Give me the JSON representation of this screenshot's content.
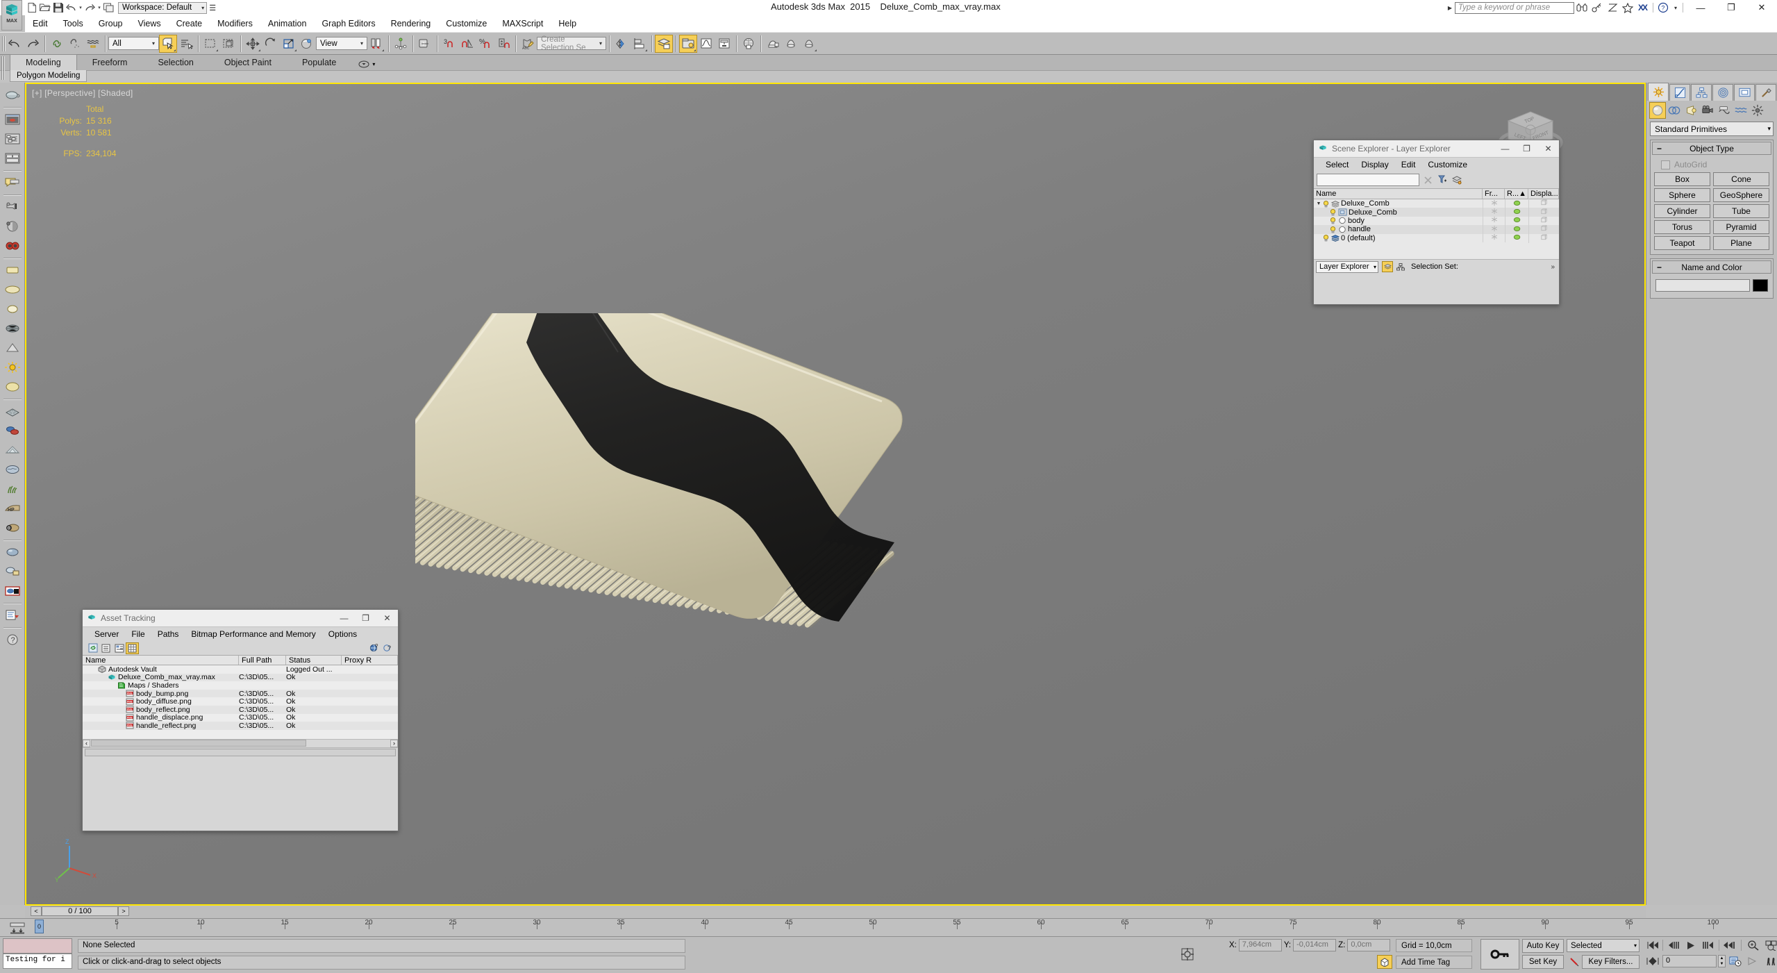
{
  "app": {
    "title": "Autodesk 3ds Max  2015    Deluxe_Comb_max_vray.max",
    "logo_label": "MAX"
  },
  "quick_access": {
    "workspace_label": "Workspace: Default",
    "items": [
      "new-icon",
      "open-icon",
      "save-icon",
      "undo-icon",
      "redo-icon",
      "project-folder-icon"
    ]
  },
  "search": {
    "placeholder": "Type a keyword or phrase"
  },
  "window_buttons": {
    "minimize": "—",
    "maximize": "❐",
    "close": "✕"
  },
  "menubar": {
    "items": [
      "Edit",
      "Tools",
      "Group",
      "Views",
      "Create",
      "Modifiers",
      "Animation",
      "Graph Editors",
      "Rendering",
      "Customize",
      "MAXScript",
      "Help"
    ]
  },
  "main_toolbar": {
    "selection_filter": "All",
    "reference_coord": "View",
    "named_selection_sets": "Create Selection Se",
    "axis_constraint_number": "3"
  },
  "ribbon": {
    "tabs": [
      "Modeling",
      "Freeform",
      "Selection",
      "Object Paint",
      "Populate"
    ],
    "active_tab": "Modeling",
    "panel_label": "Polygon Modeling"
  },
  "viewport": {
    "label": "[+] [Perspective] [Shaded]",
    "stats": {
      "header": "Total",
      "polys_label": "Polys:",
      "polys_value": "15 316",
      "verts_label": "Verts:",
      "verts_value": "10 581",
      "fps_label": "FPS:",
      "fps_value": "234,104"
    },
    "background_color": "#7e7e7e",
    "border_color": "#ffe600",
    "model": {
      "body_color": "#d8d2b8",
      "handle_color": "#1f1f1f",
      "name": "Deluxe_Comb"
    },
    "viewcube_faces": [
      "TOP",
      "LEFT",
      "FRONT"
    ],
    "axis_labels": [
      "X",
      "Y",
      "Z"
    ]
  },
  "scene_explorer": {
    "title": "Scene Explorer - Layer Explorer",
    "menus": [
      "Select",
      "Display",
      "Edit",
      "Customize"
    ],
    "search_value": "",
    "columns": [
      "Name",
      "Fr...",
      "R...▲",
      "Displa..."
    ],
    "rows": [
      {
        "name": "Deluxe_Comb",
        "indent": 0,
        "type": "layer",
        "expanded": true
      },
      {
        "name": "Deluxe_Comb",
        "indent": 1,
        "type": "group"
      },
      {
        "name": "body",
        "indent": 1,
        "type": "object"
      },
      {
        "name": "handle",
        "indent": 1,
        "type": "object"
      },
      {
        "name": "0 (default)",
        "indent": 0,
        "type": "layer-default"
      }
    ],
    "footer": {
      "mode": "Layer Explorer",
      "selection_set_label": "Selection Set:",
      "overflow": "»"
    }
  },
  "asset_tracking": {
    "title": "Asset Tracking",
    "menus": [
      "Server",
      "File",
      "Paths",
      "Bitmap Performance and Memory",
      "Options"
    ],
    "columns": [
      "Name",
      "Full Path",
      "Status",
      "Proxy R"
    ],
    "rows": [
      {
        "name": "Autodesk Vault",
        "indent": 1,
        "path": "",
        "status": "Logged Out ...",
        "icon": "vault-icon"
      },
      {
        "name": "Deluxe_Comb_max_vray.max",
        "indent": 2,
        "path": "C:\\3D\\05...",
        "status": "Ok",
        "icon": "max-file-icon"
      },
      {
        "name": "Maps / Shaders",
        "indent": 3,
        "path": "",
        "status": "",
        "icon": "maps-icon"
      },
      {
        "name": "body_bump.png",
        "indent": 4,
        "path": "C:\\3D\\05...",
        "status": "Ok",
        "icon": "png-icon"
      },
      {
        "name": "body_diffuse.png",
        "indent": 4,
        "path": "C:\\3D\\05...",
        "status": "Ok",
        "icon": "png-icon"
      },
      {
        "name": "body_reflect.png",
        "indent": 4,
        "path": "C:\\3D\\05...",
        "status": "Ok",
        "icon": "png-icon"
      },
      {
        "name": "handle_displace.png",
        "indent": 4,
        "path": "C:\\3D\\05...",
        "status": "Ok",
        "icon": "png-icon"
      },
      {
        "name": "handle_reflect.png",
        "indent": 4,
        "path": "C:\\3D\\05...",
        "status": "Ok",
        "icon": "png-icon"
      }
    ],
    "scroll_left": "‹",
    "scroll_right": "›"
  },
  "command_panel": {
    "tabs": [
      "create-tab",
      "modify-tab",
      "hierarchy-tab",
      "motion-tab",
      "display-tab",
      "utilities-tab"
    ],
    "active_tab": "create-tab",
    "categories": [
      "geometry-icon",
      "shapes-icon",
      "lights-icon",
      "cameras-icon",
      "helpers-icon",
      "spacewarps-icon",
      "systems-icon"
    ],
    "dropdown": "Standard Primitives",
    "object_type": {
      "header": "Object Type",
      "autogrid_label": "AutoGrid",
      "buttons": [
        "Box",
        "Cone",
        "Sphere",
        "GeoSphere",
        "Cylinder",
        "Tube",
        "Torus",
        "Pyramid",
        "Teapot",
        "Plane"
      ]
    },
    "name_and_color": {
      "header": "Name and Color",
      "name_value": "",
      "color": "#000000"
    }
  },
  "timeline": {
    "current_frame_label": "0 / 100",
    "prev_button": "<",
    "next_button": ">",
    "slider_value": "0",
    "ruler_ticks": [
      5,
      10,
      15,
      20,
      25,
      30,
      35,
      40,
      45,
      50,
      55,
      60,
      65,
      70,
      75,
      80,
      85,
      90,
      95,
      100
    ],
    "ruler_max": 100
  },
  "status_bar": {
    "maxscript_listener": "Testing for i",
    "selection_text": "None Selected",
    "prompt_text": "Click or click-and-drag to select objects",
    "coords": {
      "x_label": "X:",
      "x_value": "7,964cm",
      "y_label": "Y:",
      "y_value": "-0,014cm",
      "z_label": "Z:",
      "z_value": "0,0cm"
    },
    "grid_text": "Grid = 10,0cm",
    "add_time_tag": "Add Time Tag",
    "auto_key": "Auto Key",
    "set_key": "Set Key",
    "key_mode_combo": "Selected",
    "key_filters": "Key Filters...",
    "frame_field": "0"
  }
}
